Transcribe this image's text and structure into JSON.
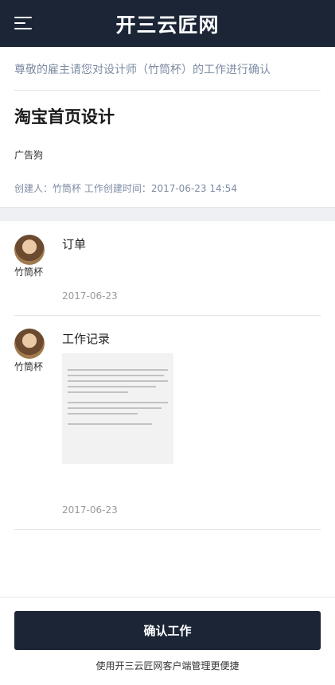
{
  "header": {
    "brand": "开三云匠网",
    "menu_icon": "hamburger-menu-icon"
  },
  "intro": "尊敬的雇主请您对设计师（竹筒杯）的工作进行确认",
  "task": {
    "title": "淘宝首页设计",
    "client": "广告狗",
    "meta": "创建人：竹筒杯 工作创建时间：2017-06-23 14:54"
  },
  "entries": [
    {
      "author": "竹筒杯",
      "title": "订单",
      "date": "2017-06-23"
    },
    {
      "author": "竹筒杯",
      "title": "工作记录",
      "date": "2017-06-23"
    }
  ],
  "footer": {
    "confirm_label": "确认工作",
    "promo": "使用开三云匠网客户端管理更便捷"
  },
  "colors": {
    "header_bg": "#1b2536",
    "accent_text": "#7d8ca3"
  }
}
